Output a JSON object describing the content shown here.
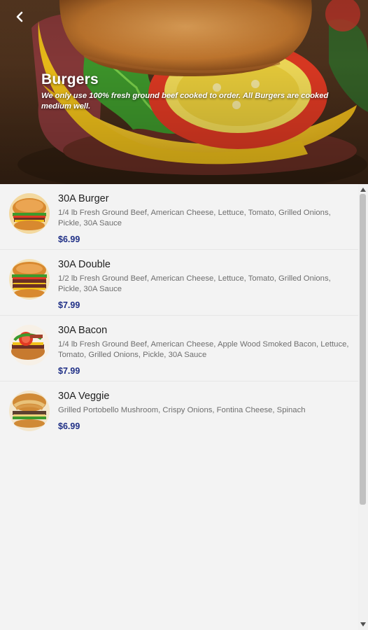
{
  "header": {
    "title": "Burgers",
    "description": "We only use 100% fresh ground beef cooked to order. All Burgers are cooked medium well.",
    "back_icon": "back-arrow-icon"
  },
  "menu_items": [
    {
      "name": "30A Burger",
      "description": "1/4 lb Fresh Ground Beef, American Cheese, Lettuce, Tomato, Grilled Onions, Pickle, 30A Sauce",
      "price": "$6.99"
    },
    {
      "name": "30A Double",
      "description": "1/2 lb Fresh Ground Beef, American Cheese, Lettuce, Tomato, Grilled Onions, Pickle, 30A Sauce",
      "price": "$7.99"
    },
    {
      "name": "30A Bacon",
      "description": "1/4 lb Fresh Ground Beef, American Cheese, Apple Wood Smoked Bacon, Lettuce, Tomato, Grilled Onions, Pickle, 30A Sauce",
      "price": "$7.99"
    },
    {
      "name": "30A Veggie",
      "description": "Grilled Portobello Mushroom, Crispy Onions, Fontina Cheese, Spinach",
      "price": "$6.99"
    }
  ],
  "colors": {
    "price": "#1f2f86",
    "background": "#f3f3f3",
    "title_text": "#ffffff"
  }
}
